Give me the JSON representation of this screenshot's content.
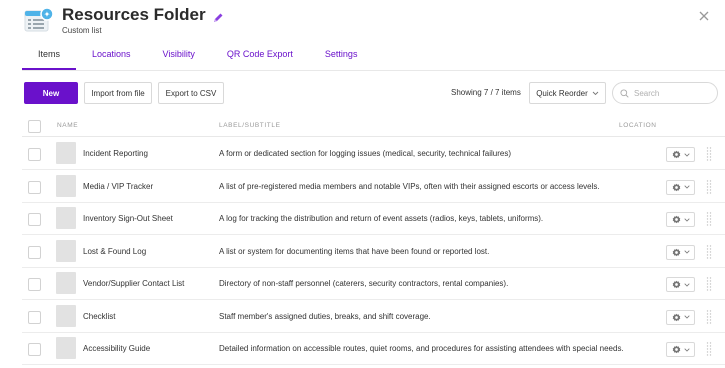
{
  "header": {
    "title": "Resources Folder",
    "subtitle": "Custom list"
  },
  "tabs": [
    {
      "label": "Items",
      "active": true
    },
    {
      "label": "Locations"
    },
    {
      "label": "Visibility"
    },
    {
      "label": "QR Code Export"
    },
    {
      "label": "Settings"
    }
  ],
  "toolbar": {
    "new_label": "New",
    "import_label": "Import from file",
    "export_label": "Export to CSV",
    "showing": "Showing 7 / 7 items",
    "reorder_label": "Quick Reorder",
    "search_placeholder": "Search"
  },
  "table": {
    "columns": {
      "name": "NAME",
      "label": "LABEL/SUBTITLE",
      "location": "LOCATION"
    },
    "rows": [
      {
        "name": "Incident Reporting",
        "label": "A form or dedicated section for logging issues (medical, security, technical failures)"
      },
      {
        "name": "Media / VIP Tracker",
        "label": "A list of pre-registered media members and notable VIPs, often with their assigned escorts or access levels."
      },
      {
        "name": "Inventory Sign-Out Sheet",
        "label": "A log for tracking the distribution and return of event assets (radios, keys, tablets, uniforms)."
      },
      {
        "name": "Lost & Found Log",
        "label": "A list or system for documenting items that have been found or reported lost."
      },
      {
        "name": "Vendor/Supplier Contact List",
        "label": "Directory of non-staff personnel (caterers, security contractors, rental companies)."
      },
      {
        "name": "Checklist",
        "label": "Staff member's assigned duties, breaks, and shift coverage."
      },
      {
        "name": "Accessibility Guide",
        "label": "Detailed information on accessible routes, quiet rooms, and procedures for assisting attendees with special needs."
      }
    ]
  },
  "colors": {
    "accent": "#6a11cb",
    "folder_icon": "#4fb3e8"
  }
}
